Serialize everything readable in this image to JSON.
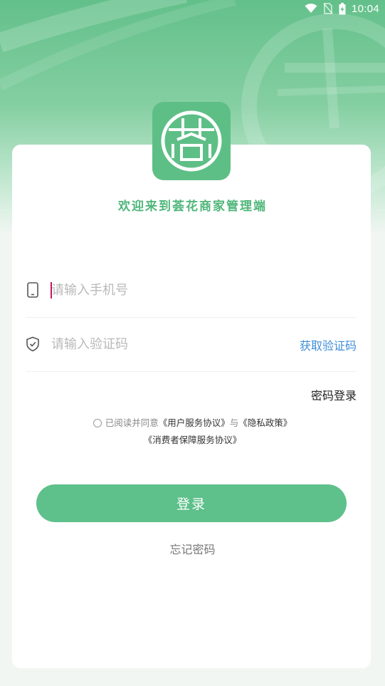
{
  "status_bar": {
    "time": "10:04",
    "icons": [
      "wifi-icon",
      "no-sim-icon",
      "battery-charging-icon"
    ]
  },
  "brand": {
    "logo_icon": "lotus-seal-logo-icon",
    "logo_glyph": "荟",
    "welcome": "欢迎来到荟花商家管理端",
    "accent_color": "#5ebf86"
  },
  "form": {
    "phone": {
      "icon": "phone-icon",
      "placeholder": "请输入手机号",
      "value": ""
    },
    "code": {
      "icon": "shield-check-icon",
      "placeholder": "请输入验证码",
      "value": "",
      "get_code_label": "获取验证码"
    },
    "password_login_label": "密码登录"
  },
  "agreement": {
    "checked": false,
    "prefix": "已阅读并同意",
    "user_agreement": "《用户服务协议》",
    "conjunction": "与",
    "privacy_policy": "《隐私政策》",
    "consumer_agreement": "《消费者保障服务协议》"
  },
  "actions": {
    "login_label": "登录",
    "forgot_label": "忘记密码"
  }
}
